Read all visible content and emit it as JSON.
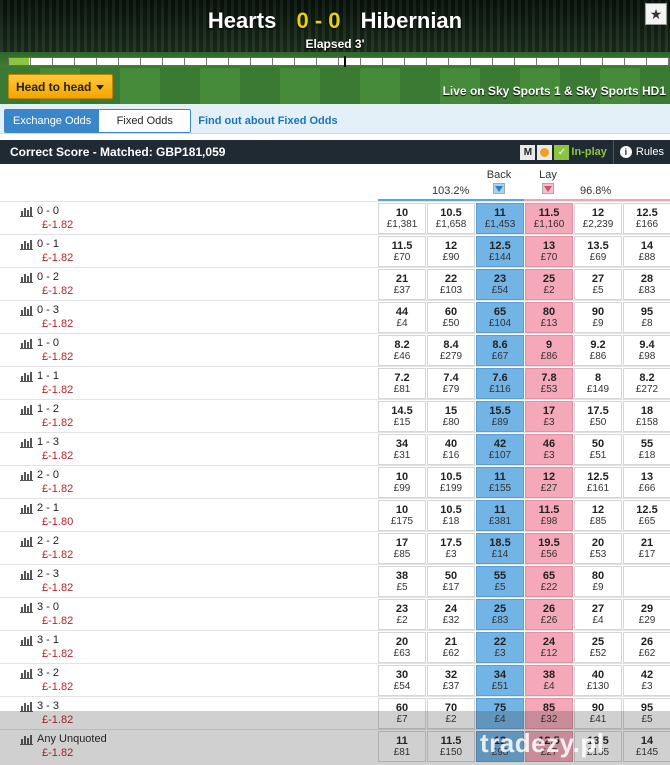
{
  "header": {
    "home_team": "Hearts",
    "score": "0 - 0",
    "away_team": "Hibernian",
    "elapsed": "Elapsed 3'",
    "favourite_icon": "star-icon",
    "head_to_head_label": "Head to head",
    "live_on": "Live on Sky Sports 1 & Sky Sports HD1",
    "match_progress_fraction": 0.03
  },
  "odds_bar": {
    "exchange_tab": "Exchange Odds",
    "fixed_tab": "Fixed Odds",
    "find_out_link": "Find out about Fixed Odds"
  },
  "market": {
    "title": "Correct Score - Matched: GBP181,059",
    "m_label": "M",
    "inplay_label": "In-play",
    "rules_label": "Rules"
  },
  "columns": {
    "back_label": "Back",
    "lay_label": "Lay",
    "back_pct": "103.2%",
    "lay_pct": "96.8%"
  },
  "colors": {
    "back_best": "#73b4e6",
    "lay_best": "#f5a8b8",
    "header_bar": "#1f2a33",
    "pl_negative": "#b8232a",
    "accent_orange": "#f5a500"
  },
  "runners": [
    {
      "name": "0 - 0",
      "pl": "£-1.82",
      "odds": [
        [
          "10",
          "£1,381"
        ],
        [
          "10.5",
          "£1,658"
        ],
        [
          "11",
          "£1,453"
        ],
        [
          "11.5",
          "£1,160"
        ],
        [
          "12",
          "£2,239"
        ],
        [
          "12.5",
          "£166"
        ]
      ]
    },
    {
      "name": "0 - 1",
      "pl": "£-1.82",
      "odds": [
        [
          "11.5",
          "£70"
        ],
        [
          "12",
          "£90"
        ],
        [
          "12.5",
          "£144"
        ],
        [
          "13",
          "£70"
        ],
        [
          "13.5",
          "£69"
        ],
        [
          "14",
          "£88"
        ]
      ]
    },
    {
      "name": "0 - 2",
      "pl": "£-1.82",
      "odds": [
        [
          "21",
          "£37"
        ],
        [
          "22",
          "£103"
        ],
        [
          "23",
          "£54"
        ],
        [
          "25",
          "£2"
        ],
        [
          "27",
          "£5"
        ],
        [
          "28",
          "£83"
        ]
      ]
    },
    {
      "name": "0 - 3",
      "pl": "£-1.82",
      "odds": [
        [
          "44",
          "£4"
        ],
        [
          "60",
          "£50"
        ],
        [
          "65",
          "£104"
        ],
        [
          "80",
          "£13"
        ],
        [
          "90",
          "£9"
        ],
        [
          "95",
          "£8"
        ]
      ]
    },
    {
      "name": "1 - 0",
      "pl": "£-1.82",
      "odds": [
        [
          "8.2",
          "£46"
        ],
        [
          "8.4",
          "£279"
        ],
        [
          "8.6",
          "£67"
        ],
        [
          "9",
          "£86"
        ],
        [
          "9.2",
          "£86"
        ],
        [
          "9.4",
          "£98"
        ]
      ]
    },
    {
      "name": "1 - 1",
      "pl": "£-1.82",
      "odds": [
        [
          "7.2",
          "£81"
        ],
        [
          "7.4",
          "£79"
        ],
        [
          "7.6",
          "£116"
        ],
        [
          "7.8",
          "£53"
        ],
        [
          "8",
          "£149"
        ],
        [
          "8.2",
          "£272"
        ]
      ]
    },
    {
      "name": "1 - 2",
      "pl": "£-1.82",
      "odds": [
        [
          "14.5",
          "£15"
        ],
        [
          "15",
          "£80"
        ],
        [
          "15.5",
          "£89"
        ],
        [
          "17",
          "£3"
        ],
        [
          "17.5",
          "£50"
        ],
        [
          "18",
          "£158"
        ]
      ]
    },
    {
      "name": "1 - 3",
      "pl": "£-1.82",
      "odds": [
        [
          "34",
          "£31"
        ],
        [
          "40",
          "£16"
        ],
        [
          "42",
          "£107"
        ],
        [
          "46",
          "£3"
        ],
        [
          "50",
          "£51"
        ],
        [
          "55",
          "£18"
        ]
      ]
    },
    {
      "name": "2 - 0",
      "pl": "£-1.82",
      "odds": [
        [
          "10",
          "£99"
        ],
        [
          "10.5",
          "£199"
        ],
        [
          "11",
          "£155"
        ],
        [
          "12",
          "£27"
        ],
        [
          "12.5",
          "£161"
        ],
        [
          "13",
          "£66"
        ]
      ]
    },
    {
      "name": "2 - 1",
      "pl": "£-1.80",
      "odds": [
        [
          "10",
          "£175"
        ],
        [
          "10.5",
          "£18"
        ],
        [
          "11",
          "£381"
        ],
        [
          "11.5",
          "£98"
        ],
        [
          "12",
          "£85"
        ],
        [
          "12.5",
          "£65"
        ]
      ]
    },
    {
      "name": "2 - 2",
      "pl": "£-1.82",
      "odds": [
        [
          "17",
          "£85"
        ],
        [
          "17.5",
          "£3"
        ],
        [
          "18.5",
          "£14"
        ],
        [
          "19.5",
          "£56"
        ],
        [
          "20",
          "£53"
        ],
        [
          "21",
          "£17"
        ]
      ]
    },
    {
      "name": "2 - 3",
      "pl": "£-1.82",
      "odds": [
        [
          "38",
          "£5"
        ],
        [
          "50",
          "£17"
        ],
        [
          "55",
          "£5"
        ],
        [
          "65",
          "£22"
        ],
        [
          "80",
          "£9"
        ],
        [
          "",
          ""
        ]
      ]
    },
    {
      "name": "3 - 0",
      "pl": "£-1.82",
      "odds": [
        [
          "23",
          "£2"
        ],
        [
          "24",
          "£32"
        ],
        [
          "25",
          "£83"
        ],
        [
          "26",
          "£26"
        ],
        [
          "27",
          "£4"
        ],
        [
          "29",
          "£29"
        ]
      ]
    },
    {
      "name": "3 - 1",
      "pl": "£-1.82",
      "odds": [
        [
          "20",
          "£63"
        ],
        [
          "21",
          "£62"
        ],
        [
          "22",
          "£3"
        ],
        [
          "24",
          "£12"
        ],
        [
          "25",
          "£52"
        ],
        [
          "26",
          "£62"
        ]
      ]
    },
    {
      "name": "3 - 2",
      "pl": "£-1.82",
      "odds": [
        [
          "30",
          "£54"
        ],
        [
          "32",
          "£37"
        ],
        [
          "34",
          "£51"
        ],
        [
          "38",
          "£4"
        ],
        [
          "40",
          "£130"
        ],
        [
          "42",
          "£3"
        ]
      ]
    },
    {
      "name": "3 - 3",
      "pl": "£-1.82",
      "odds": [
        [
          "60",
          "£7"
        ],
        [
          "70",
          "£2"
        ],
        [
          "75",
          "£4"
        ],
        [
          "85",
          "£32"
        ],
        [
          "90",
          "£41"
        ],
        [
          "95",
          "£5"
        ]
      ]
    },
    {
      "name": "Any Unquoted",
      "pl": "£-1.82",
      "odds": [
        [
          "11",
          "£81"
        ],
        [
          "11.5",
          "£150"
        ],
        [
          "12",
          "£98"
        ],
        [
          "12.5",
          "£27"
        ],
        [
          "13.5",
          "£155"
        ],
        [
          "14",
          "£145"
        ]
      ]
    }
  ],
  "watermark": "tradezy.pl"
}
